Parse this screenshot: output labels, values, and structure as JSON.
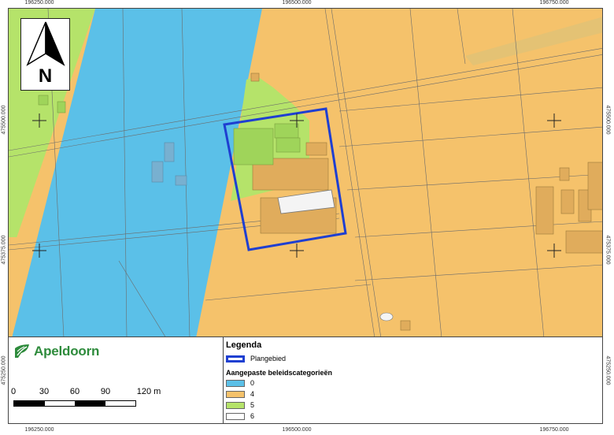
{
  "coordinates": {
    "x_labels": [
      "196250.000",
      "196500.000",
      "196750.000"
    ],
    "y_labels": [
      "475500.000",
      "475375.000",
      "475250.000"
    ]
  },
  "north_arrow": {
    "label": "N",
    "icon": "north-arrow-icon"
  },
  "logo": {
    "text": "Apeldoorn",
    "icon": "apeldoorn-logo-icon"
  },
  "scale": {
    "labels": [
      "0",
      "30",
      "60",
      "90",
      "120 m"
    ]
  },
  "legend": {
    "title": "Legenda",
    "plan_area": {
      "label": "Plangebied",
      "color": "#1f3fd1"
    },
    "categories_title": "Aangepaste beleidscategorieën",
    "categories": [
      {
        "label": "0",
        "color": "#5bc0e8"
      },
      {
        "label": "4",
        "color": "#f5c26b"
      },
      {
        "label": "5",
        "color": "#b5e36a"
      },
      {
        "label": "6",
        "color": "#ffffff"
      }
    ]
  },
  "colors": {
    "category_0": "#5bc0e8",
    "category_4": "#f5c26b",
    "category_5": "#b5e36a",
    "category_6": "#ffffff",
    "plan_boundary": "#1f3fd1",
    "logo_green": "#2e8b3c"
  }
}
